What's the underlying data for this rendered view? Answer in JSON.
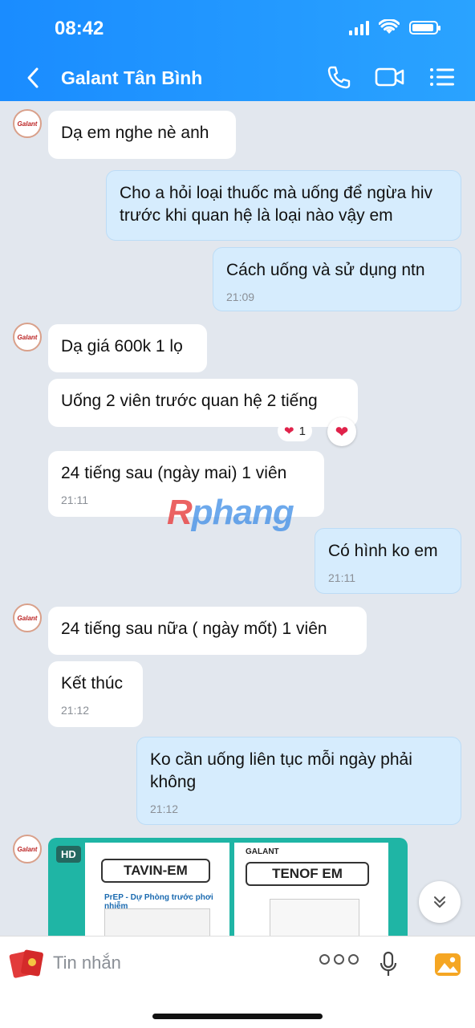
{
  "status_bar": {
    "time": "08:42"
  },
  "header": {
    "title": "Galant Tân Bình"
  },
  "messages": [
    {
      "text": "Dạ em nghe nè anh"
    },
    {
      "text": "Cho a hỏi loại thuốc mà uống để ngừa hiv trước khi quan hệ là loại nào vậy em"
    },
    {
      "text": "Cách uống và sử dụng ntn",
      "time": "21:09"
    },
    {
      "text": "Dạ giá 600k 1 lọ"
    },
    {
      "text": "Uống 2 viên trước quan hệ 2 tiếng",
      "reaction_count": "1"
    },
    {
      "text": "24 tiếng sau (ngày mai) 1 viên",
      "time": "21:11"
    },
    {
      "text": "Có hình ko em",
      "time": "21:11"
    },
    {
      "text": "24 tiếng sau nữa ( ngày mốt) 1 viên"
    },
    {
      "text": "Kết thúc",
      "time": "21:12"
    },
    {
      "text": "Ko cần uống liên tục mỗi ngày phải không",
      "time": "21:12"
    }
  ],
  "image_message": {
    "badge": "HD",
    "products": [
      "TAVIN-EM",
      "TENOF EM"
    ],
    "subtitle": "PrEP - Dự Phòng trước phơi nhiễm",
    "brand": "GALANT"
  },
  "watermark": {
    "first": "R",
    "rest": "phang"
  },
  "composer": {
    "placeholder": "Tin nhắn"
  },
  "colors": {
    "header": "#1a8cff",
    "outgoing": "#d6ecfd",
    "incoming": "#ffffff",
    "chat_bg": "#e2e7ee"
  }
}
